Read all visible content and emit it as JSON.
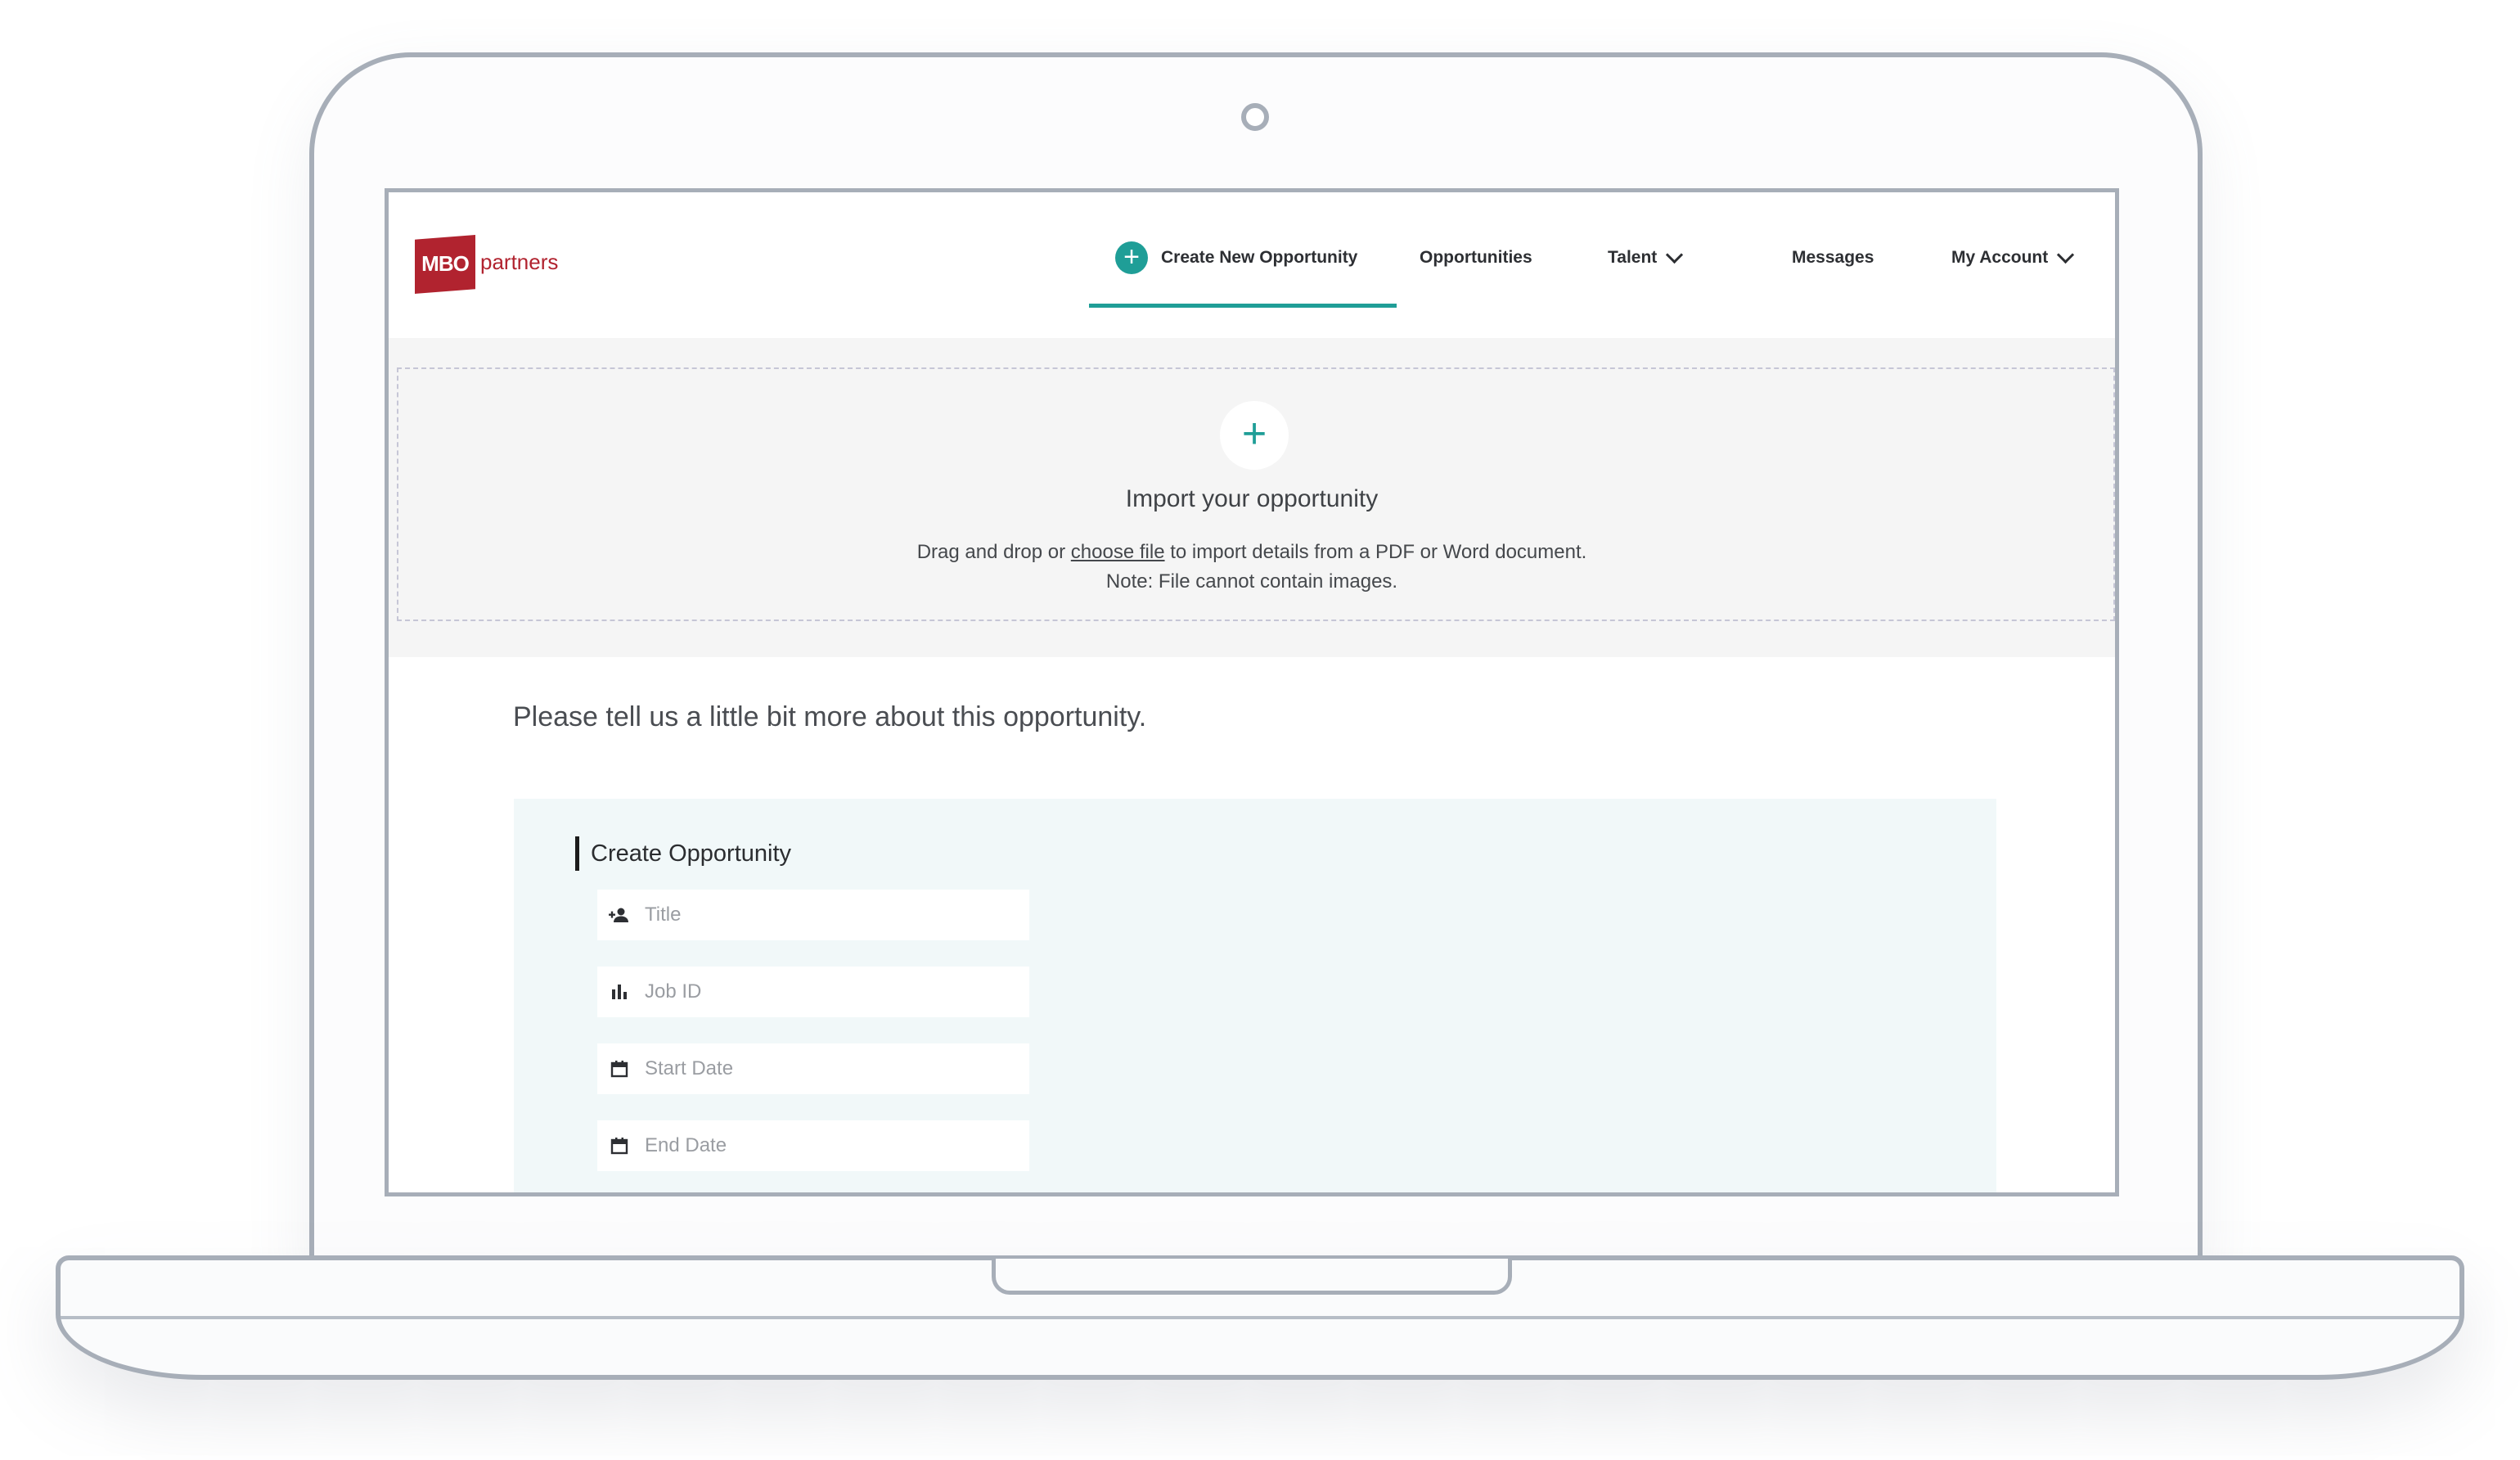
{
  "brand": {
    "logo_mark": "MBO",
    "logo_word": "partners"
  },
  "nav": {
    "create_label": "Create New Opportunity",
    "opportunities_label": "Opportunities",
    "talent_label": "Talent",
    "messages_label": "Messages",
    "account_label": "My Account"
  },
  "import": {
    "plus_glyph": "+",
    "title": "Import your opportunity",
    "line1_prefix": "Drag and drop or ",
    "line1_link": "choose file",
    "line1_suffix": " to import details from a PDF or Word document.",
    "line2": "Note: File cannot contain images."
  },
  "form": {
    "prompt": "Please tell us a little bit more about this opportunity.",
    "section_title": "Create Opportunity",
    "fields": [
      {
        "icon": "person-add-icon",
        "placeholder": "Title",
        "value": ""
      },
      {
        "icon": "bar-chart-icon",
        "placeholder": "Job ID",
        "value": ""
      },
      {
        "icon": "calendar-icon",
        "placeholder": "Start Date",
        "value": ""
      },
      {
        "icon": "calendar-icon",
        "placeholder": "End Date",
        "value": ""
      }
    ]
  },
  "colors": {
    "accent": "#1f9e97",
    "brand": "#b1232f",
    "panel": "#f1f8f9",
    "import_band": "#f5f5f5"
  }
}
